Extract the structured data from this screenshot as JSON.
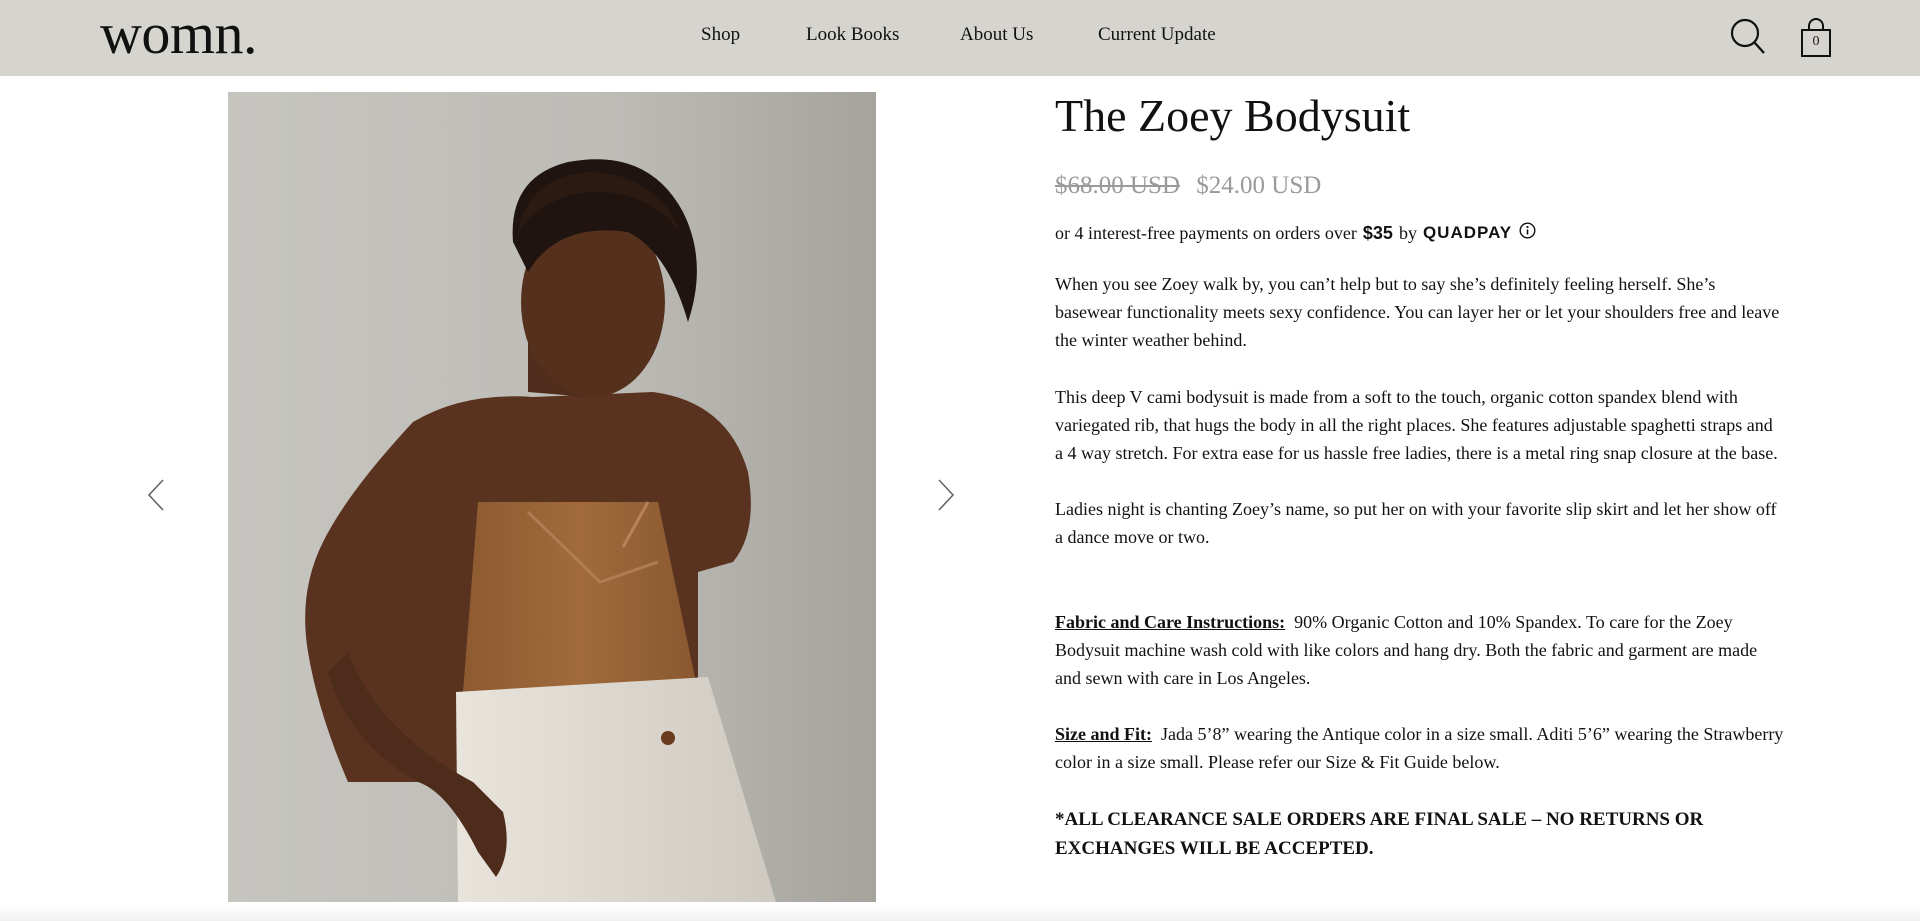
{
  "header": {
    "logo": "womn.",
    "nav": [
      "Shop",
      "Look Books",
      "About Us",
      "Current Update"
    ],
    "cart_count": "0",
    "icons": {
      "search": "search-icon",
      "cart": "shopping-bag-icon"
    }
  },
  "gallery": {
    "image_alt": "Model wearing The Zoey Bodysuit",
    "prev_icon": "chevron-left-icon",
    "next_icon": "chevron-right-icon"
  },
  "product": {
    "title": "The Zoey Bodysuit",
    "old_price": "$68.00 USD",
    "price": "$24.00 USD",
    "quadpay": {
      "prefix": "or 4 interest-free payments on orders over",
      "amount": "$35",
      "by": "by",
      "brand": "QUADPAY"
    },
    "desc1": "When you see Zoey walk by, you can’t help but to say she’s definitely feeling herself. She’s basewear functionality meets sexy confidence. You can layer her or let your shoulders free and leave the winter weather behind.",
    "desc2": "This deep V cami bodysuit is made from a soft to the touch, organic cotton spandex blend with variegated rib, that hugs the body in all the right places. She features adjustable spaghetti straps and a 4 way stretch. For extra ease for us hassle free ladies, there is a metal ring snap closure at the base.",
    "desc3": "Ladies night is chanting Zoey’s name, so put her on with your favorite slip skirt and let her show off a dance move or two.",
    "fabric_label": "Fabric and Care Instructions:",
    "fabric_text": "90% Organic Cotton and 10% Spandex. To care for the Zoey Bodysuit machine wash cold with like colors and hang dry. Both the fabric and garment are made and sewn with care in Los Angeles.",
    "size_label": "Size and Fit:",
    "size_text": "Jada 5’8” wearing the Antique color in a size small. Aditi 5’6” wearing the Strawberry color in a size small. Please refer our Size & Fit Guide below.",
    "final_sale": "*ALL CLEARANCE SALE ORDERS ARE FINAL SALE – NO RETURNS OR EXCHANGES WILL BE ACCEPTED."
  },
  "colors": {
    "header_bg": "#d6d4cf",
    "text": "#111111",
    "muted_price": "#9a9a9a",
    "bodysuit": "#9a6436"
  }
}
